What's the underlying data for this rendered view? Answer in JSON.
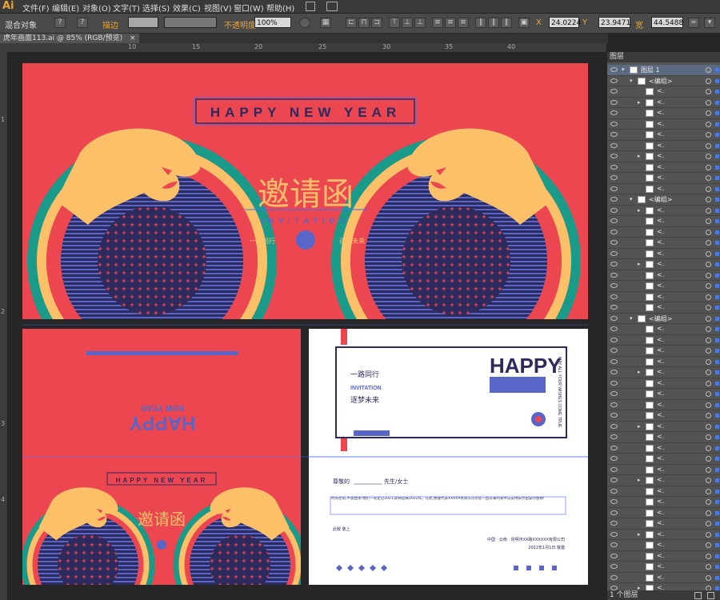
{
  "app": {
    "logo": "Ai"
  },
  "menu": [
    "文件(F)",
    "编辑(E)",
    "对象(O)",
    "文字(T)",
    "选择(S)",
    "效果(C)",
    "视图(V)",
    "窗口(W)",
    "帮助(H)"
  ],
  "control_bar": {
    "selection_label": "混合对象",
    "stroke_label": "描边",
    "opacity_label": "不透明度",
    "opacity_value": "100%",
    "x_value": "24.0224",
    "y_value": "23.9471",
    "w_label": "宽",
    "w_value": "44.5488"
  },
  "document_tab": {
    "label": "虎年画面113.ai @ 85% (RGB/预览)",
    "close": "×"
  },
  "ruler": {
    "h_ticks": [
      "10",
      "15",
      "20",
      "25",
      "30",
      "35",
      "40"
    ],
    "v_ticks": [
      "1",
      "2",
      "3",
      "4"
    ]
  },
  "artwork": {
    "colors": {
      "bg_red": "#ec4651",
      "tiger": "#fbc068",
      "navy": "#2d2a5e",
      "stripe": "#5866c8",
      "teal": "#1a9b8a",
      "sel": "#4a6cf5"
    },
    "main": {
      "happy": "HAPPY NEW YEAR",
      "title": "邀请函",
      "sub": "INVITATION",
      "left_tag": "一路同行",
      "right_tag": "逐梦未来"
    },
    "panel_left_top": {
      "happy": "HAPPY",
      "new_year": "NEW YEAR"
    },
    "panel_right_top": {
      "line1": "一路同行",
      "line2": "INVITATION",
      "line3": "逐梦未来",
      "big": "HAPPY",
      "vertical": "MAY ALL YOUR WISHES COME TRUE"
    },
    "panel_left_bottom": {
      "happy": "HAPPY NEW YEAR",
      "title": "邀请函"
    },
    "panel_right_bottom": {
      "greeting": "尊敬的",
      "greeting_suffix": "先生/女士",
      "body": "时光荏苒,不舍昼夜!我们一同走过2021,即将迎来2022年。在此,我谨代表XXXXX有限公司对您一直以来的关怀与支持表示由衷的感谢!",
      "closing": "此致 敬上",
      "signature": "中国 · 云南 · 昆明市XX路XXXXXX有限公司",
      "date": "2022年1月1日 敬邀"
    }
  },
  "layers_panel": {
    "title": "图层",
    "layer_name": "图层 1",
    "group_label": "<编组>",
    "path_label": "<.",
    "footer": "1 个图层"
  }
}
